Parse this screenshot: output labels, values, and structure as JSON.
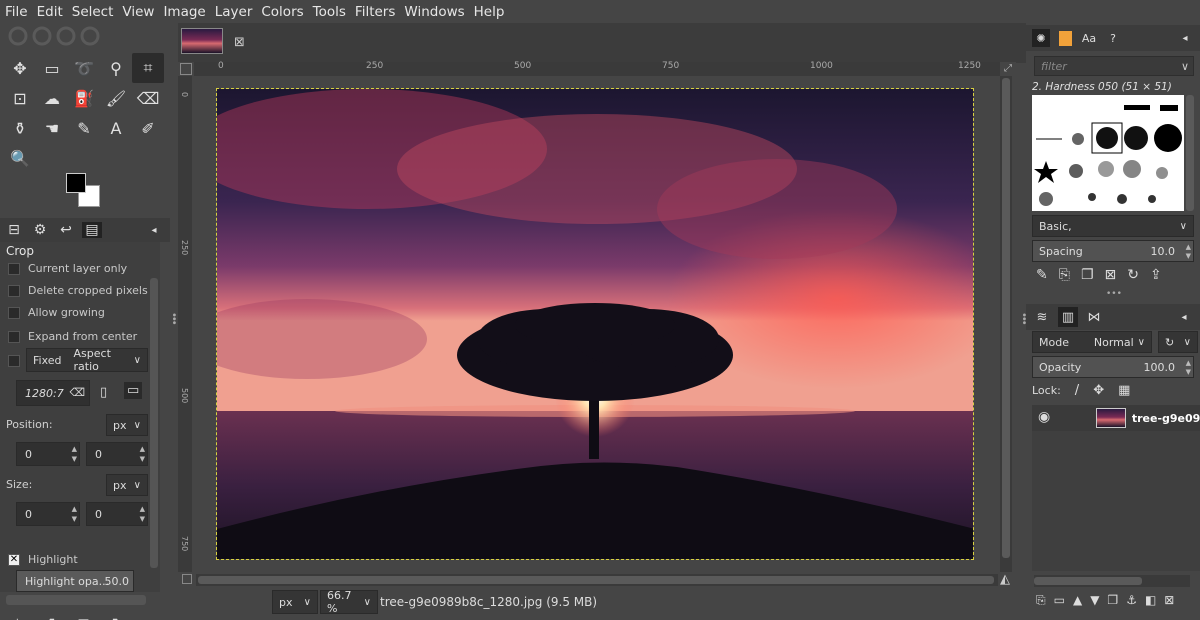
{
  "menu": [
    "File",
    "Edit",
    "Select",
    "View",
    "Image",
    "Layer",
    "Colors",
    "Tools",
    "Filters",
    "Windows",
    "Help"
  ],
  "tool_options": {
    "title": "Crop",
    "current_layer_only": "Current layer only",
    "delete_cropped": "Delete cropped pixels",
    "allow_growing": "Allow growing",
    "expand_center": "Expand from center",
    "fixed": "Fixed",
    "aspect_ratio": "Aspect ratio",
    "ratio_value": "1280:7",
    "position_label": "Position:",
    "position_unit": "px",
    "position_x": "0",
    "position_y": "0",
    "size_label": "Size:",
    "size_unit": "px",
    "size_w": "0",
    "size_h": "0",
    "highlight": "Highlight",
    "highlight_opacity_label": "Highlight opa...",
    "highlight_opacity_value": "50.0"
  },
  "ruler": {
    "top": [
      "0",
      "250",
      "500",
      "750",
      "1000",
      "1250"
    ],
    "left": [
      "0",
      "250",
      "500",
      "750"
    ]
  },
  "status": {
    "unit": "px",
    "zoom": "66.7 %",
    "file": "tree-g9e0989b8c_1280.jpg (9.5 MB)"
  },
  "brushes": {
    "filter_placeholder": "filter",
    "brush_name": "2. Hardness 050 (51 × 51)",
    "preset": "Basic,",
    "spacing_label": "Spacing",
    "spacing_value": "10.0"
  },
  "layers": {
    "mode_label": "Mode",
    "mode_value": "Normal",
    "opacity_label": "Opacity",
    "opacity_value": "100.0",
    "lock_label": "Lock:",
    "layer_name": "tree-g9e09"
  },
  "colors": {
    "foreground": "#000000",
    "background": "#ffffff",
    "selection_border": "#d8d040"
  }
}
